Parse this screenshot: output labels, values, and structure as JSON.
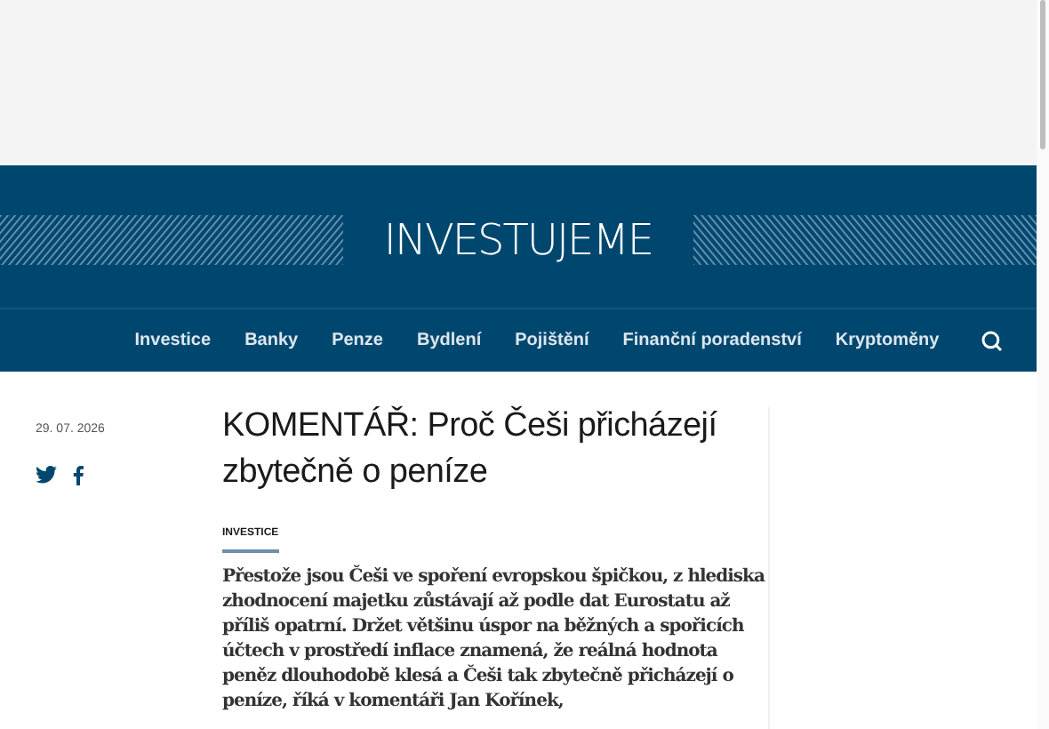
{
  "header": {
    "logo": "INVESTUJEME"
  },
  "nav": {
    "items": [
      "Investice",
      "Banky",
      "Penze",
      "Bydlení",
      "Pojištění",
      "Finanční poradenství",
      "Kryptoměny"
    ]
  },
  "article": {
    "date": "29. 07. 2026",
    "title": "KOMENTÁŘ: Proč Češi přicházejí zbytečně o peníze",
    "category": "INVESTICE",
    "perex": "Přestože jsou Češi ve spoření evropskou špičkou, z hlediska zhodnocení majetku zůstávají až podle dat Eurostatu až příliš opatrní. Držet většinu úspor na běžných a spořicích účtech v prostředí inflace znamená, že reálná hodnota peněz dlouhodobě klesá a Češi tak zbytečně přicházejí o peníze, říká v komentáři Jan Kořínek,"
  }
}
